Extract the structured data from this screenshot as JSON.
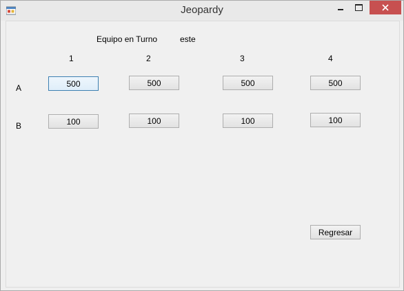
{
  "window": {
    "title": "Jeopardy",
    "icons": {
      "app": "app-icon",
      "minimize": "minimize-icon",
      "maximize": "maximize-icon",
      "close": "close-icon"
    },
    "accent_close": "#c75050"
  },
  "turn": {
    "label": "Equipo en Turno",
    "value": "este"
  },
  "columns": [
    "1",
    "2",
    "3",
    "4"
  ],
  "rows": [
    {
      "label": "A",
      "values": [
        "500",
        "500",
        "500",
        "500"
      ]
    },
    {
      "label": "B",
      "values": [
        "100",
        "100",
        "100",
        "100"
      ]
    }
  ],
  "back_button": "Regresar"
}
